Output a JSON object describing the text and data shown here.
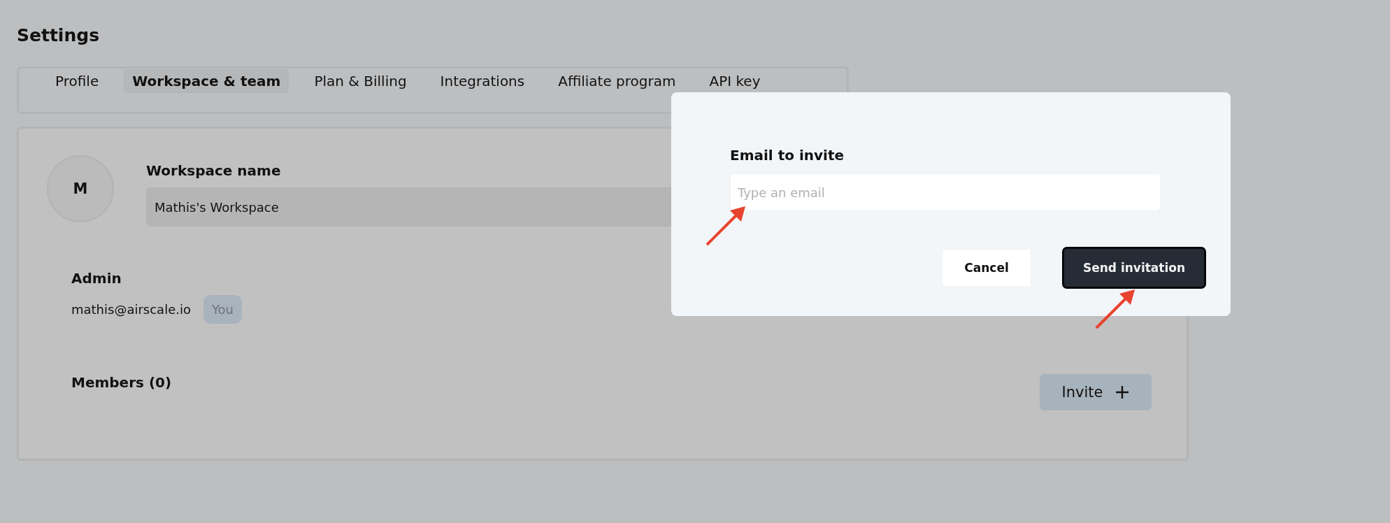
{
  "page_title": "Settings",
  "tabs": [
    {
      "label": "Profile",
      "selected": false
    },
    {
      "label": "Workspace & team",
      "selected": true
    },
    {
      "label": "Plan & Billing",
      "selected": false
    },
    {
      "label": "Integrations",
      "selected": false
    },
    {
      "label": "Affiliate program",
      "selected": false
    },
    {
      "label": "API key",
      "selected": false
    }
  ],
  "workspace": {
    "avatar_initial": "M",
    "name_label": "Workspace name",
    "name_value": "Mathis's Workspace"
  },
  "admin": {
    "heading": "Admin",
    "email": "mathis@airscale.io",
    "badge": "You"
  },
  "members": {
    "heading": "Members (0)",
    "invite_button": "Invite"
  },
  "modal": {
    "label": "Email to invite",
    "placeholder": "Type an email",
    "cancel": "Cancel",
    "submit": "Send invitation"
  }
}
